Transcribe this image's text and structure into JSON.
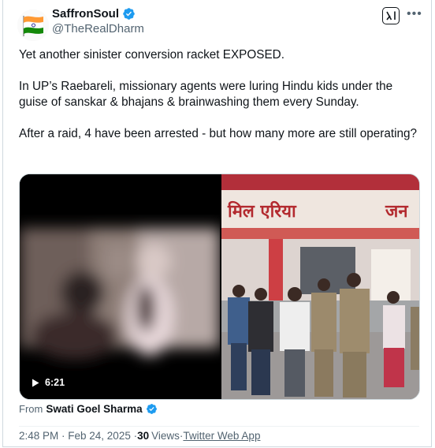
{
  "author": {
    "display_name": "SaffronSoul",
    "handle": "@TheRealDharm"
  },
  "tweet": {
    "text": "Yet another sinister conversion racket EXPOSED.\n\nIn UP’s Raebareli, missionary agents were luring Hindu kids under the guise of sanskar & bhajans & brainwashing them every Sunday.\n\nAfter a raid, 4 have been arrested - but how many more are still operating?"
  },
  "media": {
    "video_duration": "6:21",
    "sign_text_left": "मिल एरिया",
    "sign_text_right": "जन"
  },
  "source": {
    "prefix": "From",
    "name": "Swati Goel Sharma"
  },
  "meta": {
    "timestamp": "2:48 PM · Feb 24, 2025 · ",
    "views_count": "30",
    "views_label": "Views",
    "separator": "·",
    "app": "Twitter Web App"
  },
  "colors": {
    "verified_blue": "#1d9bf0",
    "text_secondary": "#536471",
    "border": "#cfd9de"
  },
  "icons": [
    "india-flag-icon",
    "verified-badge-icon",
    "grok-icon",
    "more-icon",
    "play-icon"
  ]
}
